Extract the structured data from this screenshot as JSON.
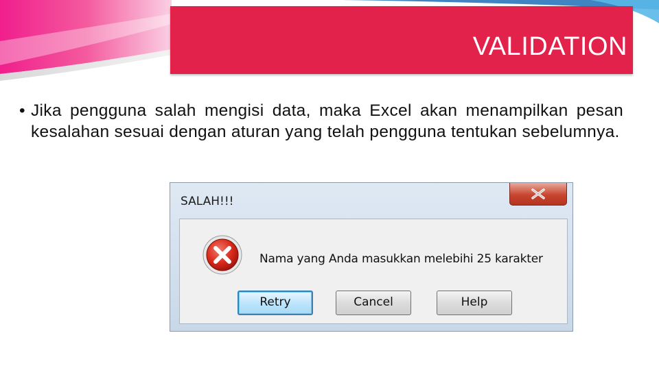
{
  "slide": {
    "title": "VALIDATION",
    "bullet": "Jika pengguna salah mengisi data, maka Excel akan menampilkan pesan kesalahan sesuai dengan aturan yang telah pengguna tentukan sebelumnya.",
    "title_color": "#e3224b"
  },
  "dialog": {
    "title": "SALAH!!!",
    "message": "Nama yang Anda masukkan melebihi 25 karakter",
    "icon": "error-icon",
    "close_icon": "close-icon",
    "buttons": {
      "retry": "Retry",
      "cancel": "Cancel",
      "help": "Help"
    }
  }
}
